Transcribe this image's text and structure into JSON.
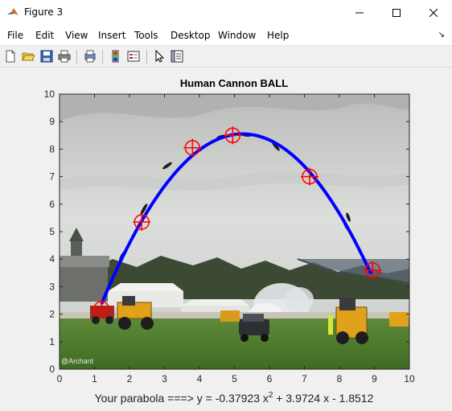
{
  "window": {
    "title": "Figure 3"
  },
  "menu": [
    "File",
    "Edit",
    "View",
    "Insert",
    "Tools",
    "Desktop",
    "Window",
    "Help"
  ],
  "toolbar": [
    "new-figure-icon",
    "open-file-icon",
    "save-icon",
    "print-icon",
    "print-preview-icon",
    "colorbar-icon",
    "legend-icon",
    "edit-plot-arrow-icon",
    "property-inspector-icon"
  ],
  "plot": {
    "title": "Human Cannon BALL",
    "caption_prefix": "Your parabola ===>  y = -0.37923 x",
    "caption_sup": "2",
    "caption_suffix": " + 3.9724 x - 1.8512"
  },
  "chart_data": {
    "type": "line",
    "title": "Human Cannon BALL",
    "xlim": [
      0,
      10
    ],
    "ylim": [
      0,
      10
    ],
    "xticks": [
      0,
      1,
      2,
      3,
      4,
      5,
      6,
      7,
      8,
      9,
      10
    ],
    "yticks": [
      0,
      1,
      2,
      3,
      4,
      5,
      6,
      7,
      8,
      9,
      10
    ],
    "series": [
      {
        "kind": "fitted-curve",
        "color": "#0000ff",
        "coefficients": [
          -0.37923,
          3.9724,
          -1.8512
        ],
        "x_range": [
          1.2,
          8.9
        ]
      },
      {
        "kind": "markers",
        "color": "#ff0000",
        "x": [
          1.2,
          2.35,
          3.8,
          4.95,
          7.15,
          8.95
        ],
        "y": [
          2.2,
          5.35,
          8.05,
          8.5,
          7.0,
          3.6
        ]
      }
    ],
    "background": "photo of a human cannonball flying over a show ground with tents, trucks and smoke",
    "watermark": "@Archant",
    "grid": false
  }
}
